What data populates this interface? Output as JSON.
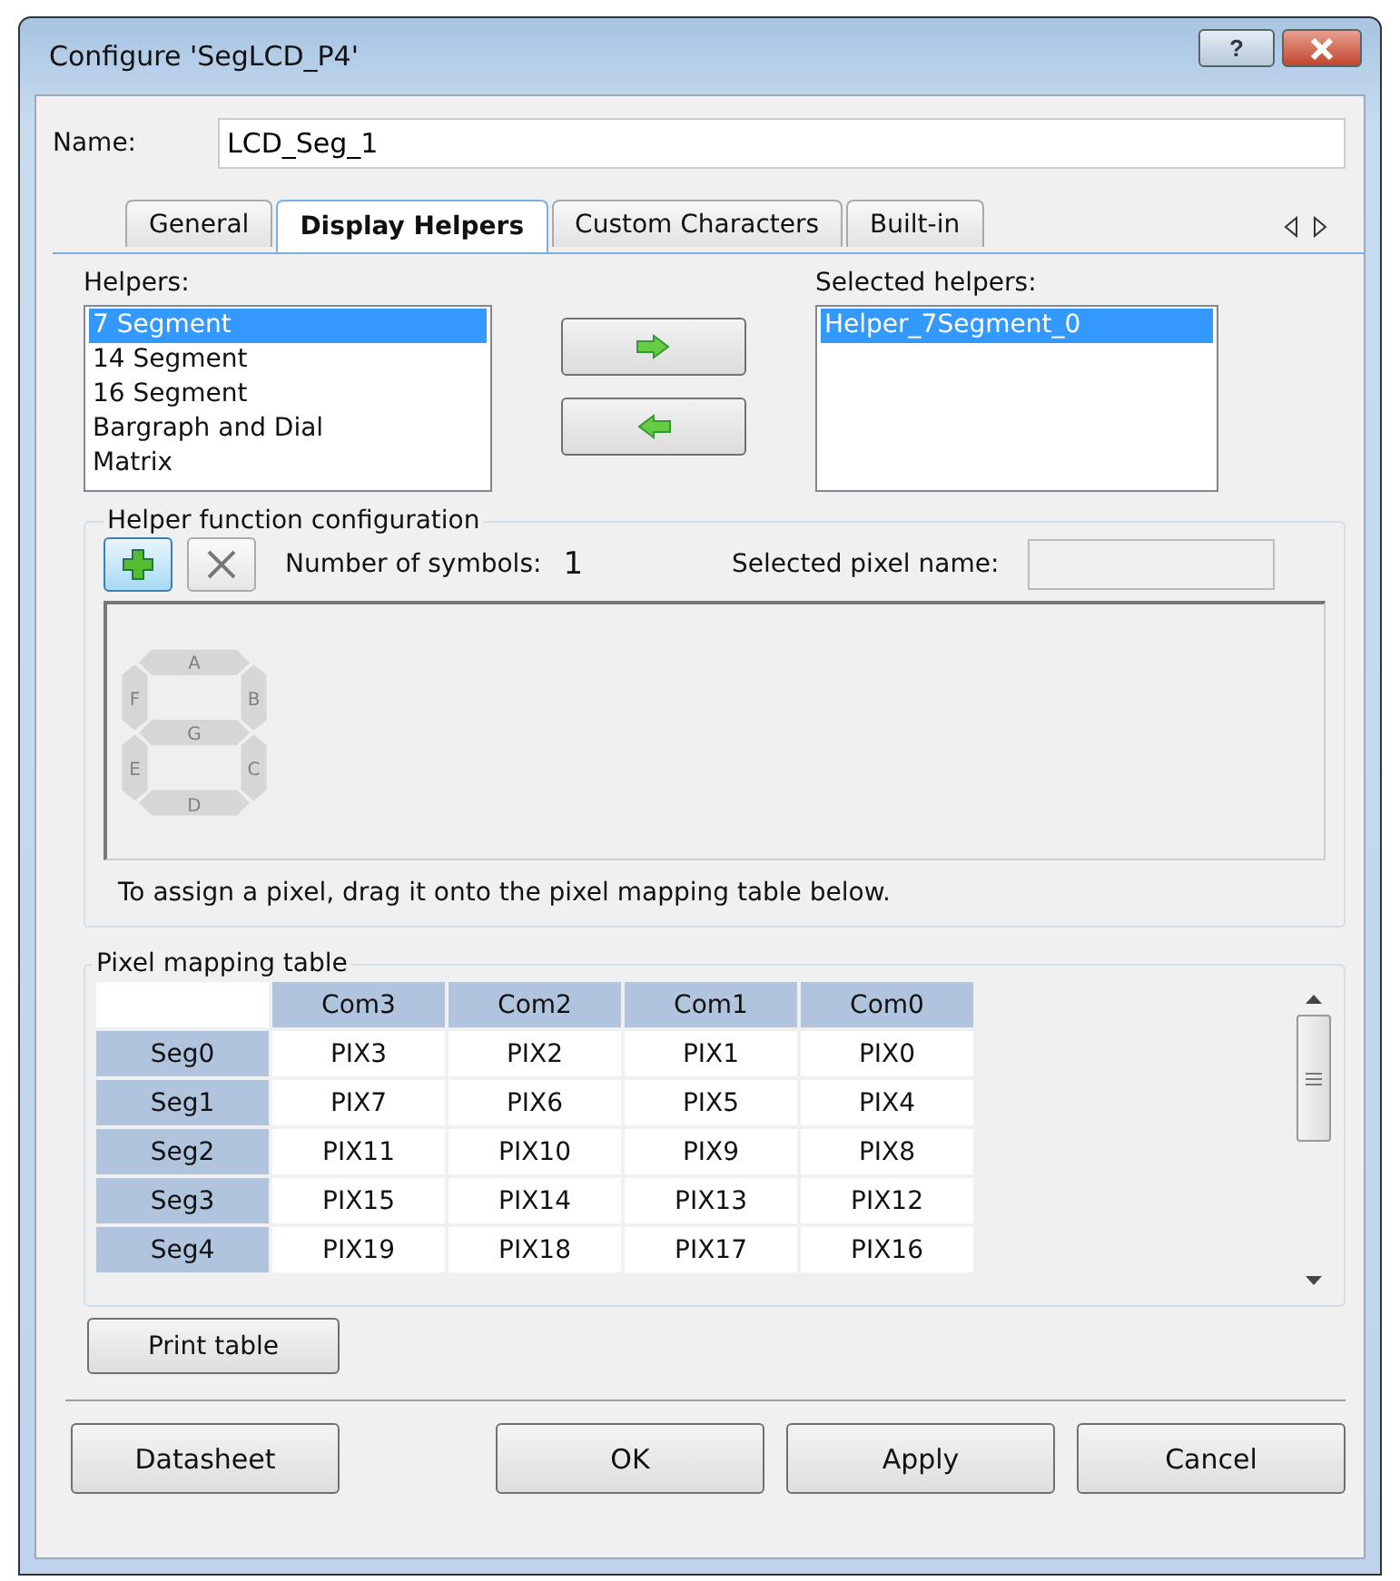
{
  "window": {
    "title": "Configure 'SegLCD_P4'",
    "help_button": "?"
  },
  "name_field": {
    "label": "Name:",
    "value": "LCD_Seg_1"
  },
  "tabs": [
    {
      "label": "General",
      "selected": false
    },
    {
      "label": "Display Helpers",
      "selected": true
    },
    {
      "label": "Custom Characters",
      "selected": false
    },
    {
      "label": "Built-in",
      "selected": false
    }
  ],
  "helpers": {
    "label": "Helpers:",
    "items": [
      {
        "label": "7 Segment",
        "selected": true
      },
      {
        "label": "14 Segment",
        "selected": false
      },
      {
        "label": "16 Segment",
        "selected": false
      },
      {
        "label": "Bargraph and Dial",
        "selected": false
      },
      {
        "label": "Matrix",
        "selected": false
      }
    ]
  },
  "selected_helpers": {
    "label": "Selected helpers:",
    "items": [
      {
        "label": "Helper_7Segment_0",
        "selected": true
      }
    ]
  },
  "helper_config": {
    "title": "Helper function configuration",
    "symbols_label": "Number of symbols:",
    "symbols_value": "1",
    "pixel_name_label": "Selected pixel name:",
    "segments": [
      "A",
      "F",
      "B",
      "G",
      "E",
      "C",
      "D"
    ],
    "hint": "To assign a pixel, drag it onto the pixel mapping table below."
  },
  "pixel_table": {
    "title": "Pixel mapping table",
    "columns": [
      "Com3",
      "Com2",
      "Com1",
      "Com0"
    ],
    "rows": [
      {
        "segment": "Seg0",
        "cells": [
          "PIX3",
          "PIX2",
          "PIX1",
          "PIX0"
        ]
      },
      {
        "segment": "Seg1",
        "cells": [
          "PIX7",
          "PIX6",
          "PIX5",
          "PIX4"
        ]
      },
      {
        "segment": "Seg2",
        "cells": [
          "PIX11",
          "PIX10",
          "PIX9",
          "PIX8"
        ]
      },
      {
        "segment": "Seg3",
        "cells": [
          "PIX15",
          "PIX14",
          "PIX13",
          "PIX12"
        ]
      },
      {
        "segment": "Seg4",
        "cells": [
          "PIX19",
          "PIX18",
          "PIX17",
          "PIX16"
        ]
      }
    ],
    "print_button": "Print table"
  },
  "buttons": {
    "datasheet": "Datasheet",
    "ok": "OK",
    "apply": "Apply",
    "cancel": "Cancel"
  }
}
